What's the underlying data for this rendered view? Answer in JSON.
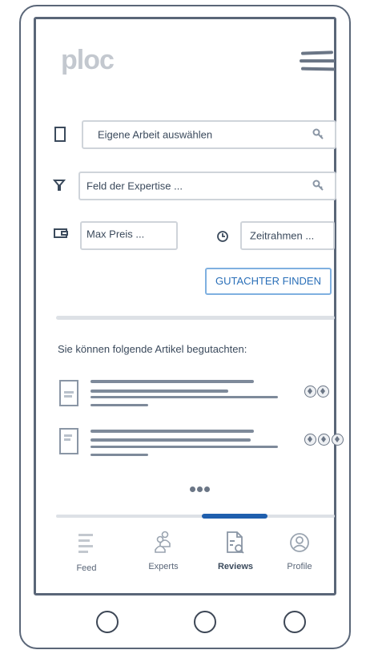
{
  "app": {
    "logo": "ploc"
  },
  "search": {
    "work_placeholder": "Eigene Arbeit auswählen",
    "expertise_placeholder": "Feld der Expertise ...",
    "price_placeholder": "Max Preis ...",
    "timeframe_placeholder": "Zeitrahmen ..."
  },
  "actions": {
    "find_label": "GUTACHTER FINDEN"
  },
  "articles": {
    "heading": "Sie können folgende Artikel begutachten:",
    "items": [
      {
        "badge_count": 2
      },
      {
        "badge_count": 3
      }
    ]
  },
  "pager": {
    "active_index": 2,
    "count": 4
  },
  "nav": {
    "items": [
      {
        "label": "Feed",
        "icon": "feed-icon"
      },
      {
        "label": "Experts",
        "icon": "experts-icon"
      },
      {
        "label": "Reviews",
        "icon": "reviews-icon"
      },
      {
        "label": "Profile",
        "icon": "profile-icon"
      }
    ],
    "active": "Reviews"
  },
  "colors": {
    "accent": "#2a6fb8",
    "frame": "#5a6678",
    "muted": "#c3c8cf"
  }
}
